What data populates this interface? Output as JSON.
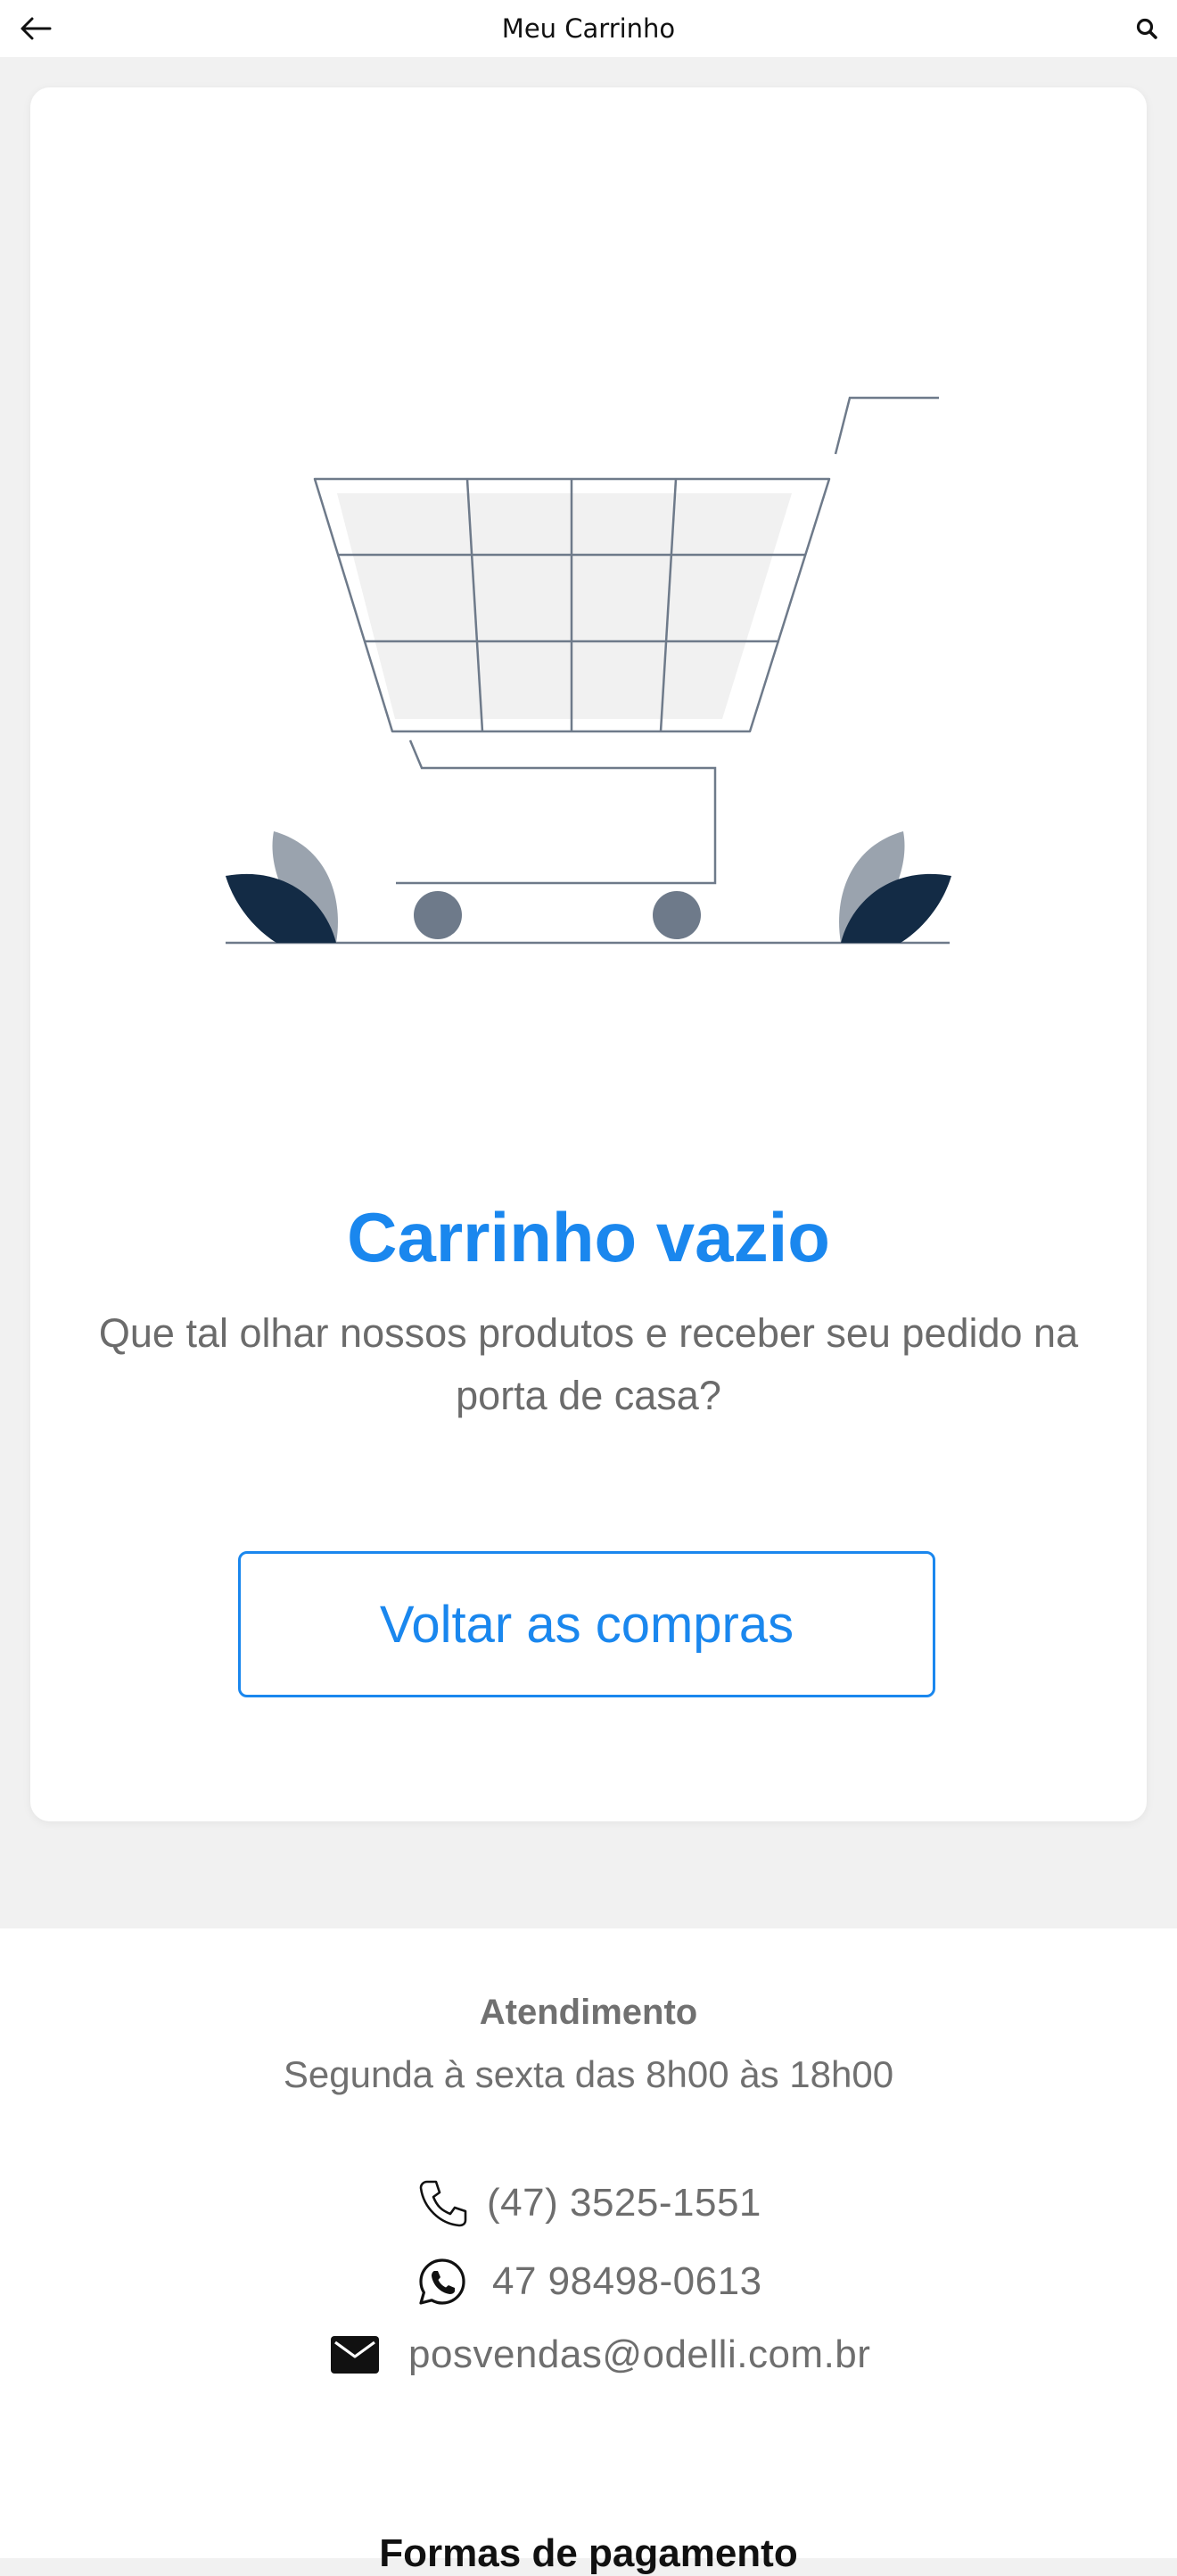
{
  "header": {
    "title": "Meu Carrinho",
    "back_icon": "arrow-left-icon",
    "search_icon": "search-icon"
  },
  "empty_state": {
    "illustration": "empty-shopping-cart-illustration",
    "title": "Carrinho vazio",
    "description": "Que tal olhar nossos produtos e receber seu pedido na porta de casa?",
    "button_label": "Voltar as compras"
  },
  "footer": {
    "support_title": "Atendimento",
    "support_hours": "Segunda à sexta das 8h00 às 18h00",
    "phone": "(47) 3525-1551",
    "whatsapp": "47 98498-0613",
    "email": "posvendas@odelli.com.br",
    "payment_title": "Formas de pagamento"
  },
  "colors": {
    "accent": "#1a87ee",
    "text_muted": "#6b6b6b",
    "page_background": "#f1f1f1",
    "leaf_dark": "#132b45",
    "leaf_light": "#9aa3ae",
    "cart_line": "#6e7a8a"
  }
}
